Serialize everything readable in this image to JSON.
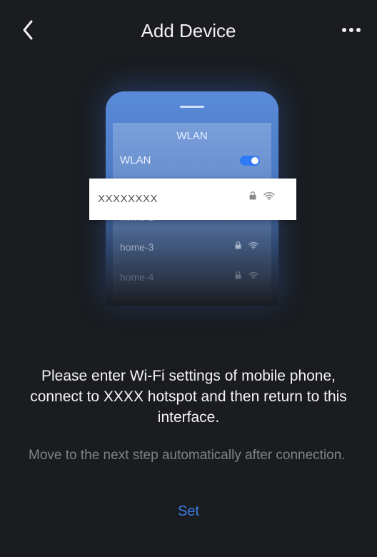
{
  "header": {
    "title": "Add Device",
    "back_icon": "chevron-left-icon",
    "more_icon": "more-horizontal-icon"
  },
  "illustration": {
    "screen_title": "WLAN",
    "wlan_label": "WLAN",
    "wlan_enabled": true,
    "selected_network": "XXXXXXXX",
    "networks": [
      "home-2",
      "home-3",
      "home-4"
    ]
  },
  "instruction": "Please enter Wi-Fi settings of mobile phone, connect to XXXX hotspot and then return to this interface.",
  "note": "Move to the next step automatically after connection.",
  "set_label": "Set",
  "colors": {
    "background": "#1a1c20",
    "accent": "#3a7ee0",
    "toggle": "#2f7af5"
  }
}
